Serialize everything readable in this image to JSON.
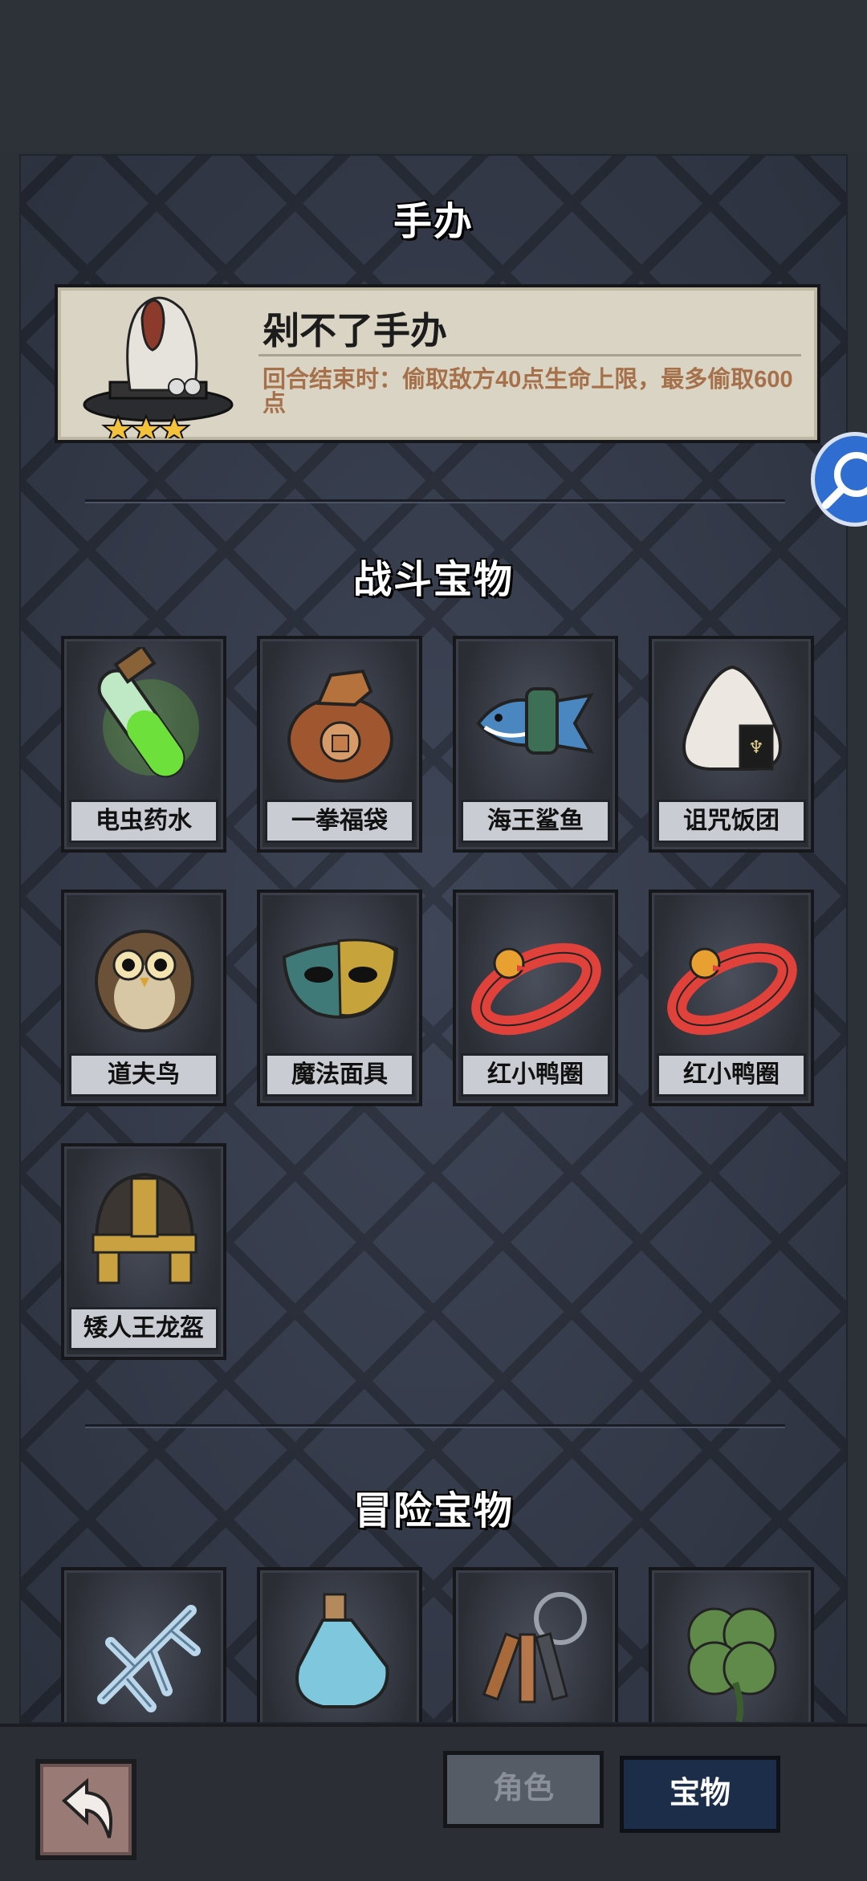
{
  "figure_section": {
    "title": "手办"
  },
  "figure_card": {
    "name": "剁不了手办",
    "description": "回合结束时：偷取敌方40点生命上限，最多偷取600点",
    "stars": 3
  },
  "battle_section": {
    "title": "战斗宝物",
    "items": [
      {
        "label": "电虫药水",
        "icon": "green-potion-vial-icon"
      },
      {
        "label": "一拳福袋",
        "icon": "fist-lucky-bag-icon"
      },
      {
        "label": "海王鲨鱼",
        "icon": "shark-fish-icon"
      },
      {
        "label": "诅咒饭团",
        "icon": "cursed-rice-ball-icon"
      },
      {
        "label": "道夫鸟",
        "icon": "owl-icon"
      },
      {
        "label": "魔法面具",
        "icon": "magic-mask-icon"
      },
      {
        "label": "红小鸭圈",
        "icon": "red-duck-ring-icon"
      },
      {
        "label": "红小鸭圈",
        "icon": "red-duck-ring-icon"
      },
      {
        "label": "矮人王龙盔",
        "icon": "dwarf-king-helmet-icon"
      }
    ]
  },
  "adventure_section": {
    "title": "冒险宝物",
    "items": [
      {
        "icon": "ice-coral-icon"
      },
      {
        "icon": "blue-potion-bottle-icon"
      },
      {
        "icon": "key-ring-icon"
      },
      {
        "icon": "four-leaf-clover-icon"
      }
    ]
  },
  "bottom_nav": {
    "tab_role": "角色",
    "tab_treasure": "宝物"
  },
  "colors": {
    "accent_blue": "#2f6ed0",
    "desc_text": "#a6714a"
  }
}
